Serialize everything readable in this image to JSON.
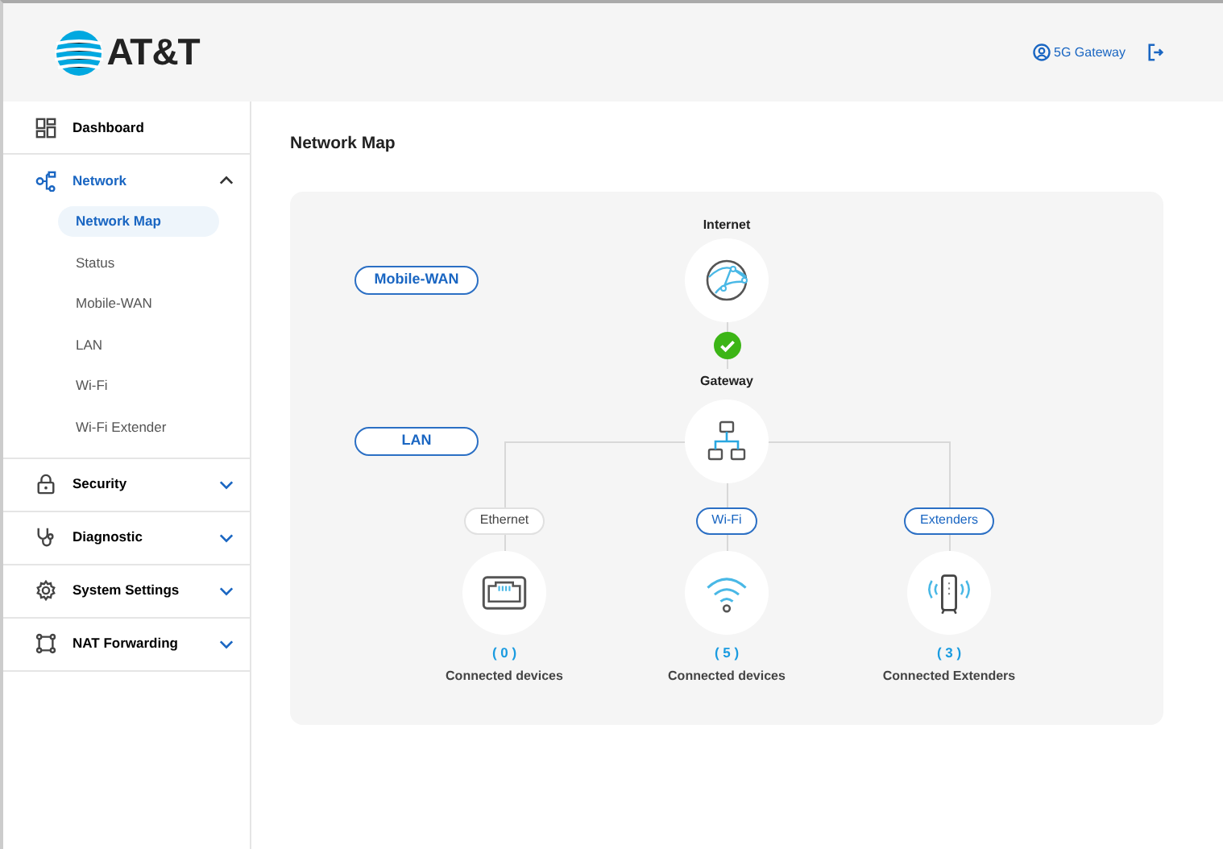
{
  "header": {
    "logo_text": "AT&T",
    "device": "5G Gateway"
  },
  "sidebar": {
    "items": [
      {
        "kind": "link",
        "label": "Dashboard"
      },
      {
        "kind": "group",
        "label": "Network",
        "expanded": true,
        "children": [
          {
            "label": "Network Map",
            "selected": true
          },
          {
            "label": "Status",
            "selected": false
          },
          {
            "label": "Mobile-WAN",
            "selected": false
          },
          {
            "label": "LAN",
            "selected": false
          },
          {
            "label": "Wi-Fi",
            "selected": false
          },
          {
            "label": "Wi-Fi Extender",
            "selected": false
          }
        ]
      },
      {
        "kind": "group",
        "label": "Security",
        "expanded": false
      },
      {
        "kind": "group",
        "label": "Diagnostic",
        "expanded": false
      },
      {
        "kind": "group",
        "label": "System Settings",
        "expanded": false
      },
      {
        "kind": "group",
        "label": "NAT Forwarding",
        "expanded": false
      }
    ]
  },
  "page_title": "Network Map",
  "map": {
    "wan_label": "Mobile-WAN",
    "lan_label": "LAN",
    "internet_label": "Internet",
    "gateway_label": "Gateway",
    "connected": true,
    "branches": [
      {
        "kind": "ethernet",
        "label": "Ethernet",
        "active": false,
        "count": "( 0 )",
        "caption": "Connected devices"
      },
      {
        "kind": "wifi",
        "label": "Wi-Fi",
        "active": true,
        "count": "( 5 )",
        "caption": "Connected devices"
      },
      {
        "kind": "extender",
        "label": "Extenders",
        "active": true,
        "count": "( 3 )",
        "caption": "Connected Extenders"
      }
    ]
  }
}
